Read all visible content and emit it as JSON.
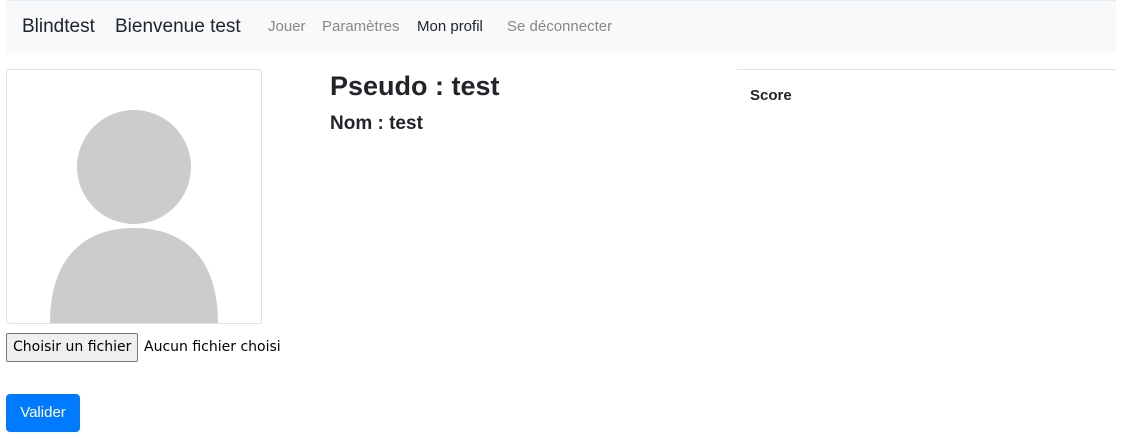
{
  "navbar": {
    "brand": "Blindtest",
    "welcome": "Bienvenue test",
    "links": [
      {
        "label": "Jouer"
      },
      {
        "label": "Paramètres"
      },
      {
        "label": "Mon profil"
      },
      {
        "label": "Se déconnecter"
      }
    ],
    "active_link": "Mon profil"
  },
  "profile": {
    "avatar_icon": "default-user-avatar",
    "pseudo": "Pseudo : test",
    "nom": "Nom : test"
  },
  "upload": {
    "choose_label": "Choisir un fichier",
    "no_file_label": "Aucun fichier choisi",
    "submit_label": "Valider"
  },
  "score": {
    "header": "Score"
  },
  "colors": {
    "primary": "#007bff",
    "navbar_bg": "#f8f9fa",
    "avatar_gray": "#cccccc",
    "muted_link": "#888888"
  }
}
